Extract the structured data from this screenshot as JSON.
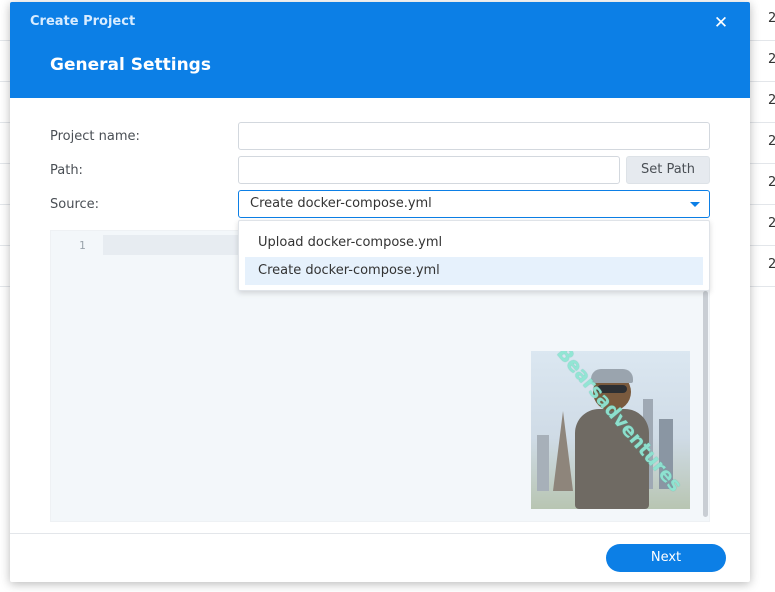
{
  "background_list": {
    "rows": [
      "2",
      "2",
      "2",
      "2",
      "2",
      "2",
      "2"
    ]
  },
  "dialog": {
    "title": "Create Project",
    "close_icon": "close-icon",
    "step_title": "General Settings",
    "accent_color": "#0c7fe6",
    "fields": {
      "project_name_label": "Project name:",
      "project_name_value": "",
      "path_label": "Path:",
      "path_value": "",
      "set_path_label": "Set Path",
      "source_label": "Source:",
      "source_value": "Create docker-compose.yml"
    },
    "source_options": [
      {
        "label": "Upload docker-compose.yml",
        "selected": false
      },
      {
        "label": "Create docker-compose.yml",
        "selected": true
      }
    ],
    "editor": {
      "line_number": "1",
      "content": ""
    },
    "watermark": {
      "text": "Bearsadventures",
      "image": "bear-photo"
    },
    "next_label": "Next"
  }
}
